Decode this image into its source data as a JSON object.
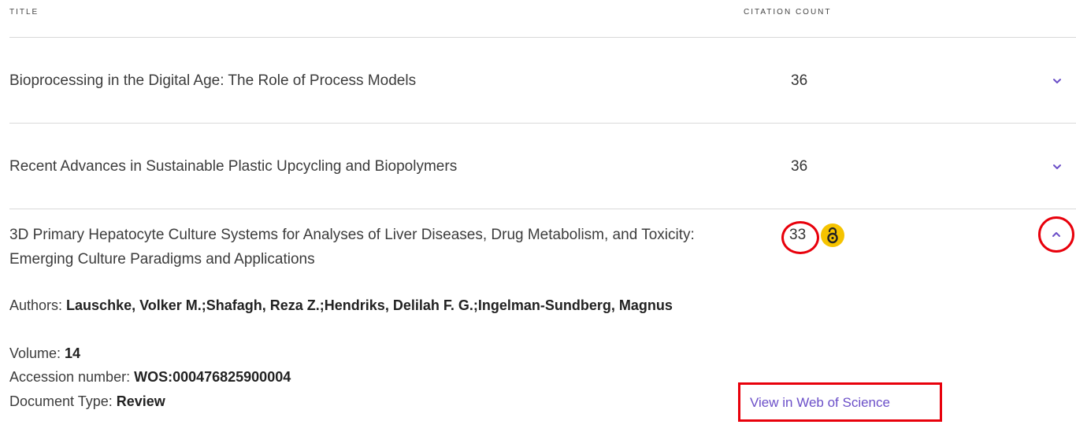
{
  "headers": {
    "title": "TITLE",
    "citation_count": "CITATION COUNT"
  },
  "rows": [
    {
      "title": "Bioprocessing in the Digital Age: The Role of Process Models",
      "count": "36"
    },
    {
      "title": "Recent Advances in Sustainable Plastic Upcycling and Biopolymers",
      "count": "36"
    }
  ],
  "expanded": {
    "title": "3D Primary Hepatocyte Culture Systems for Analyses of Liver Diseases, Drug Metabolism, and Toxicity: Emerging Culture Paradigms and Applications",
    "count": "33",
    "authors_label": "Authors: ",
    "authors_value": "Lauschke, Volker M.;Shafagh, Reza Z.;Hendriks, Delilah F. G.;Ingelman-Sundberg, Magnus",
    "volume_label": "Volume: ",
    "volume_value": "14",
    "accession_label": "Accession number: ",
    "accession_value": "WOS:000476825900004",
    "doctype_label": "Document Type: ",
    "doctype_value": "Review",
    "wos_link": "View in Web of Science"
  },
  "icons": {
    "chevron": "chevron-down-icon",
    "chevron_up": "chevron-up-icon",
    "open_access": "open-access-icon"
  },
  "colors": {
    "accent": "#6b4fc8",
    "highlight": "#e8000b",
    "open_access": "#f5c300"
  }
}
